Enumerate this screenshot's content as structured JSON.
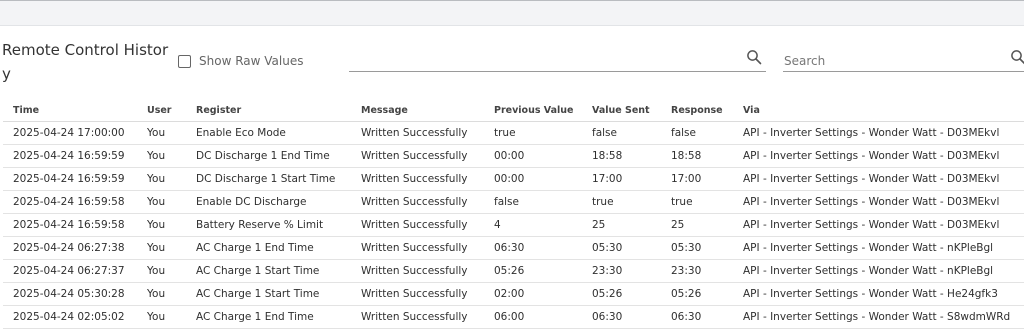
{
  "page": {
    "title": "Remote Control History"
  },
  "controls": {
    "show_raw_label": "Show Raw Values",
    "show_raw_checked": false,
    "filter_input": {
      "value": "",
      "placeholder": ""
    },
    "search_input": {
      "value": "",
      "placeholder": "Search"
    }
  },
  "icons": [
    "search-icon",
    "search-icon"
  ],
  "table": {
    "columns": [
      "Time",
      "User",
      "Register",
      "Message",
      "Previous Value",
      "Value Sent",
      "Response",
      "Via"
    ],
    "rows": [
      [
        "2025-04-24 17:00:00",
        "You",
        "Enable Eco Mode",
        "Written Successfully",
        "true",
        "false",
        "false",
        "API - Inverter Settings - Wonder Watt - D03MEkvl"
      ],
      [
        "2025-04-24 16:59:59",
        "You",
        "DC Discharge 1 End Time",
        "Written Successfully",
        "00:00",
        "18:58",
        "18:58",
        "API - Inverter Settings - Wonder Watt - D03MEkvl"
      ],
      [
        "2025-04-24 16:59:59",
        "You",
        "DC Discharge 1 Start Time",
        "Written Successfully",
        "00:00",
        "17:00",
        "17:00",
        "API - Inverter Settings - Wonder Watt - D03MEkvl"
      ],
      [
        "2025-04-24 16:59:58",
        "You",
        "Enable DC Discharge",
        "Written Successfully",
        "false",
        "true",
        "true",
        "API - Inverter Settings - Wonder Watt - D03MEkvl"
      ],
      [
        "2025-04-24 16:59:58",
        "You",
        "Battery Reserve % Limit",
        "Written Successfully",
        "4",
        "25",
        "25",
        "API - Inverter Settings - Wonder Watt - D03MEkvl"
      ],
      [
        "2025-04-24 06:27:38",
        "You",
        "AC Charge 1 End Time",
        "Written Successfully",
        "06:30",
        "05:30",
        "05:30",
        "API - Inverter Settings - Wonder Watt - nKPleBgl"
      ],
      [
        "2025-04-24 06:27:37",
        "You",
        "AC Charge 1 Start Time",
        "Written Successfully",
        "05:26",
        "23:30",
        "23:30",
        "API - Inverter Settings - Wonder Watt - nKPleBgl"
      ],
      [
        "2025-04-24 05:30:28",
        "You",
        "AC Charge 1 Start Time",
        "Written Successfully",
        "02:00",
        "05:26",
        "05:26",
        "API - Inverter Settings - Wonder Watt - He24gfk3"
      ],
      [
        "2025-04-24 02:05:02",
        "You",
        "AC Charge 1 End Time",
        "Written Successfully",
        "06:00",
        "06:30",
        "06:30",
        "API - Inverter Settings - Wonder Watt - S8wdmWRd"
      ]
    ]
  }
}
